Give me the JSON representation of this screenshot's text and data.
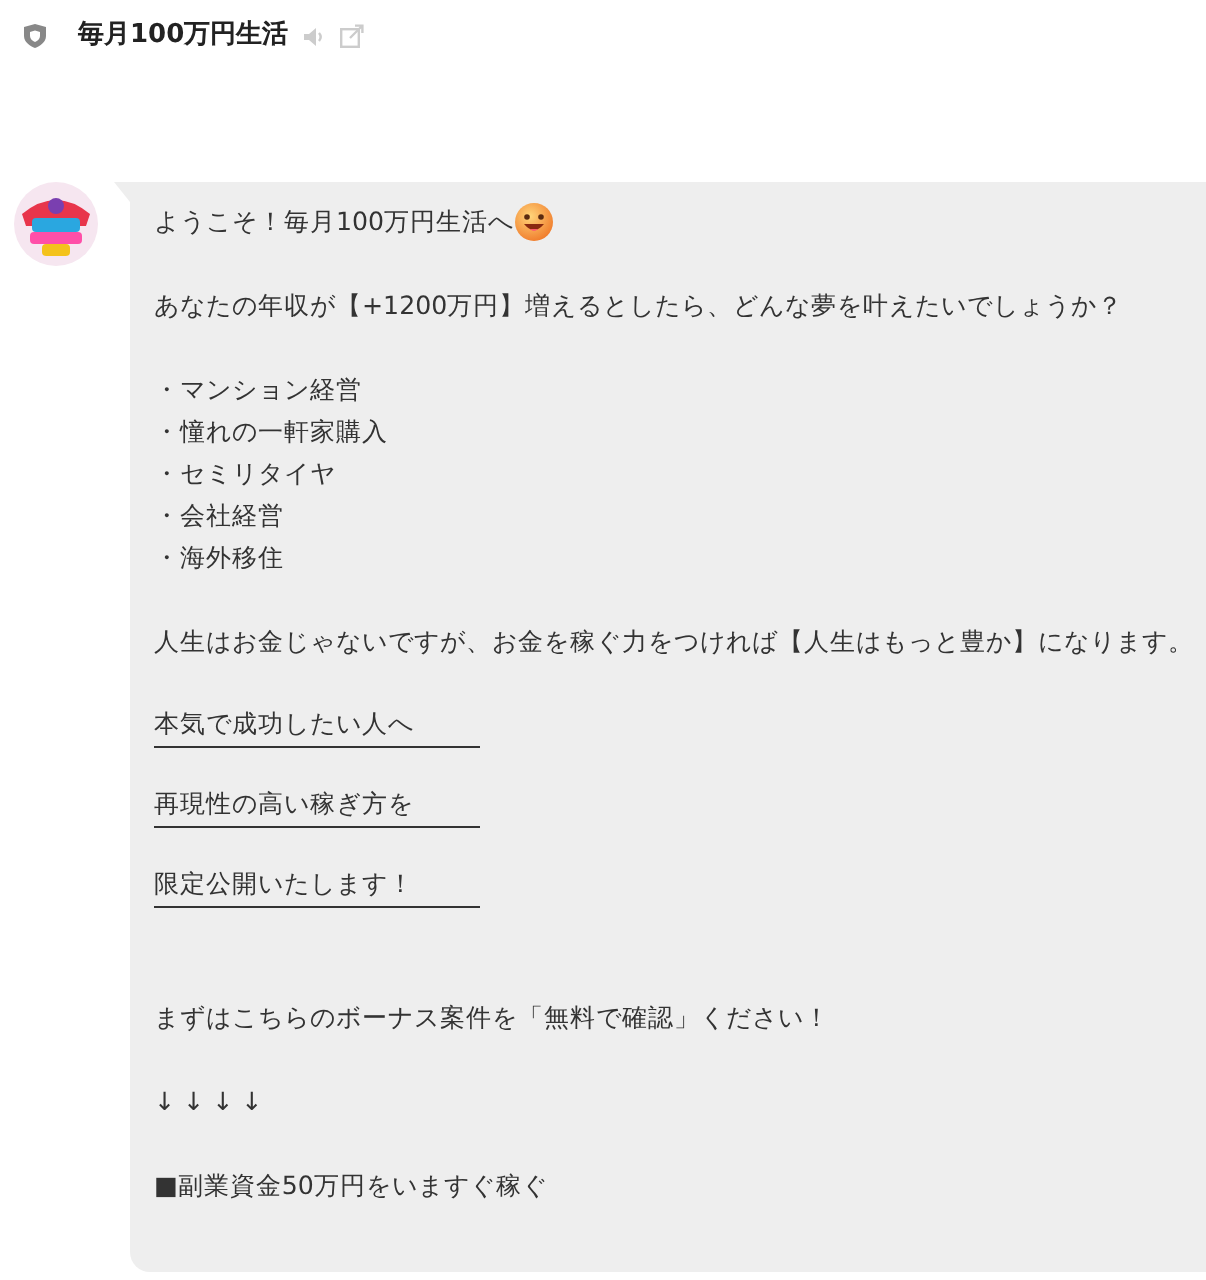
{
  "header": {
    "title": "毎月100万円生活"
  },
  "message": {
    "blocks": [
      {
        "kind": "greeting",
        "text": "ようこそ！毎月100万円生活へ"
      },
      {
        "kind": "text",
        "text": "あなたの年収が【+1200万円】増えるとしたら、どんな夢を叶えたいでしょうか？"
      },
      {
        "kind": "list",
        "items": [
          "・マンション経営",
          "・憧れの一軒家購入",
          "・セミリタイヤ",
          "・会社経営",
          "・海外移住"
        ]
      },
      {
        "kind": "text",
        "text": "人生はお金じゃないですが、お金を稼ぐ力をつければ【人生はもっと豊か】になります。"
      },
      {
        "kind": "underlined",
        "text": "本気で成功したい人へ"
      },
      {
        "kind": "underlined",
        "text": "再現性の高い稼ぎ方を"
      },
      {
        "kind": "underlined",
        "text": "限定公開いたします！"
      },
      {
        "kind": "text",
        "text": "まずはこちらのボーナス案件を「無料で確認」ください！"
      },
      {
        "kind": "text",
        "text": "↓ ↓ ↓ ↓"
      },
      {
        "kind": "text",
        "text": "■副業資金50万円をいますぐ稼ぐ"
      }
    ]
  }
}
